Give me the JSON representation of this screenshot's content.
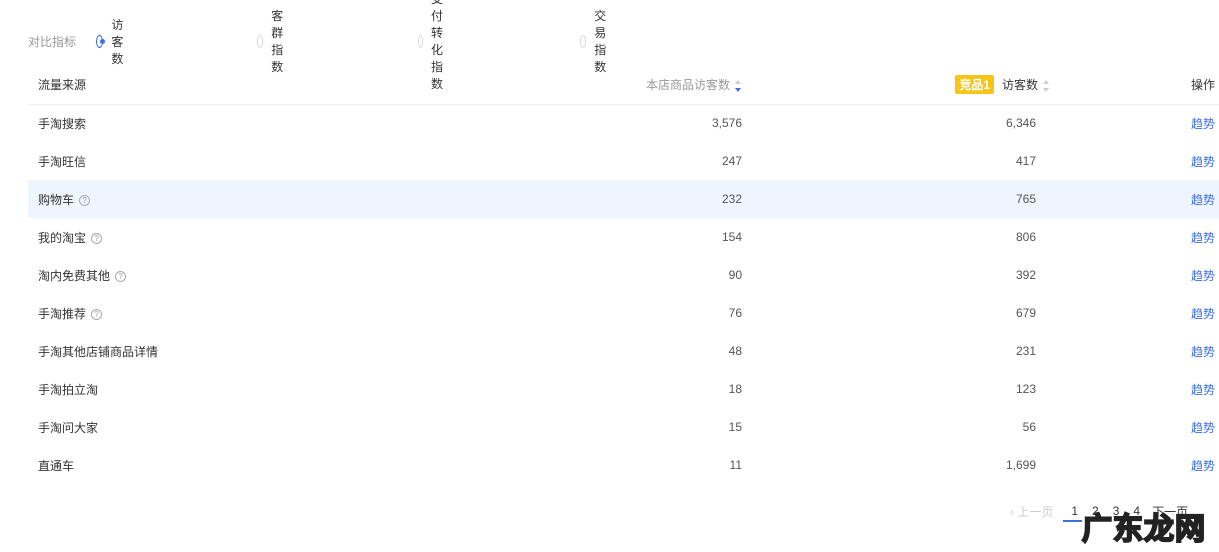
{
  "filter": {
    "label": "对比指标",
    "options": [
      {
        "label": "访客数",
        "selected": true
      },
      {
        "label": "客群指数",
        "selected": false
      },
      {
        "label": "支付转化指数",
        "selected": false
      },
      {
        "label": "交易指数",
        "selected": false
      }
    ]
  },
  "table": {
    "headers": {
      "source": "流量来源",
      "own": "本店商品访客数",
      "badge": "竞品1",
      "competitor": "访客数",
      "action": "操作"
    },
    "rows": [
      {
        "source": "手淘搜索",
        "own": "3,576",
        "comp": "6,346",
        "action": "趋势",
        "help": false
      },
      {
        "source": "手淘旺信",
        "own": "247",
        "comp": "417",
        "action": "趋势",
        "help": false
      },
      {
        "source": "购物车",
        "own": "232",
        "comp": "765",
        "action": "趋势",
        "help": true
      },
      {
        "source": "我的淘宝",
        "own": "154",
        "comp": "806",
        "action": "趋势",
        "help": true
      },
      {
        "source": "淘内免费其他",
        "own": "90",
        "comp": "392",
        "action": "趋势",
        "help": true
      },
      {
        "source": "手淘推荐",
        "own": "76",
        "comp": "679",
        "action": "趋势",
        "help": true
      },
      {
        "source": "手淘其他店铺商品详情",
        "own": "48",
        "comp": "231",
        "action": "趋势",
        "help": false
      },
      {
        "source": "手淘拍立淘",
        "own": "18",
        "comp": "123",
        "action": "趋势",
        "help": false
      },
      {
        "source": "手淘问大家",
        "own": "15",
        "comp": "56",
        "action": "趋势",
        "help": false
      },
      {
        "source": "直通车",
        "own": "11",
        "comp": "1,699",
        "action": "趋势",
        "help": false
      }
    ]
  },
  "pager": {
    "prev": "上一页",
    "pages": [
      "1",
      "2",
      "3",
      "4"
    ],
    "current": "1",
    "next": "下一页"
  },
  "watermark": "广东龙网"
}
